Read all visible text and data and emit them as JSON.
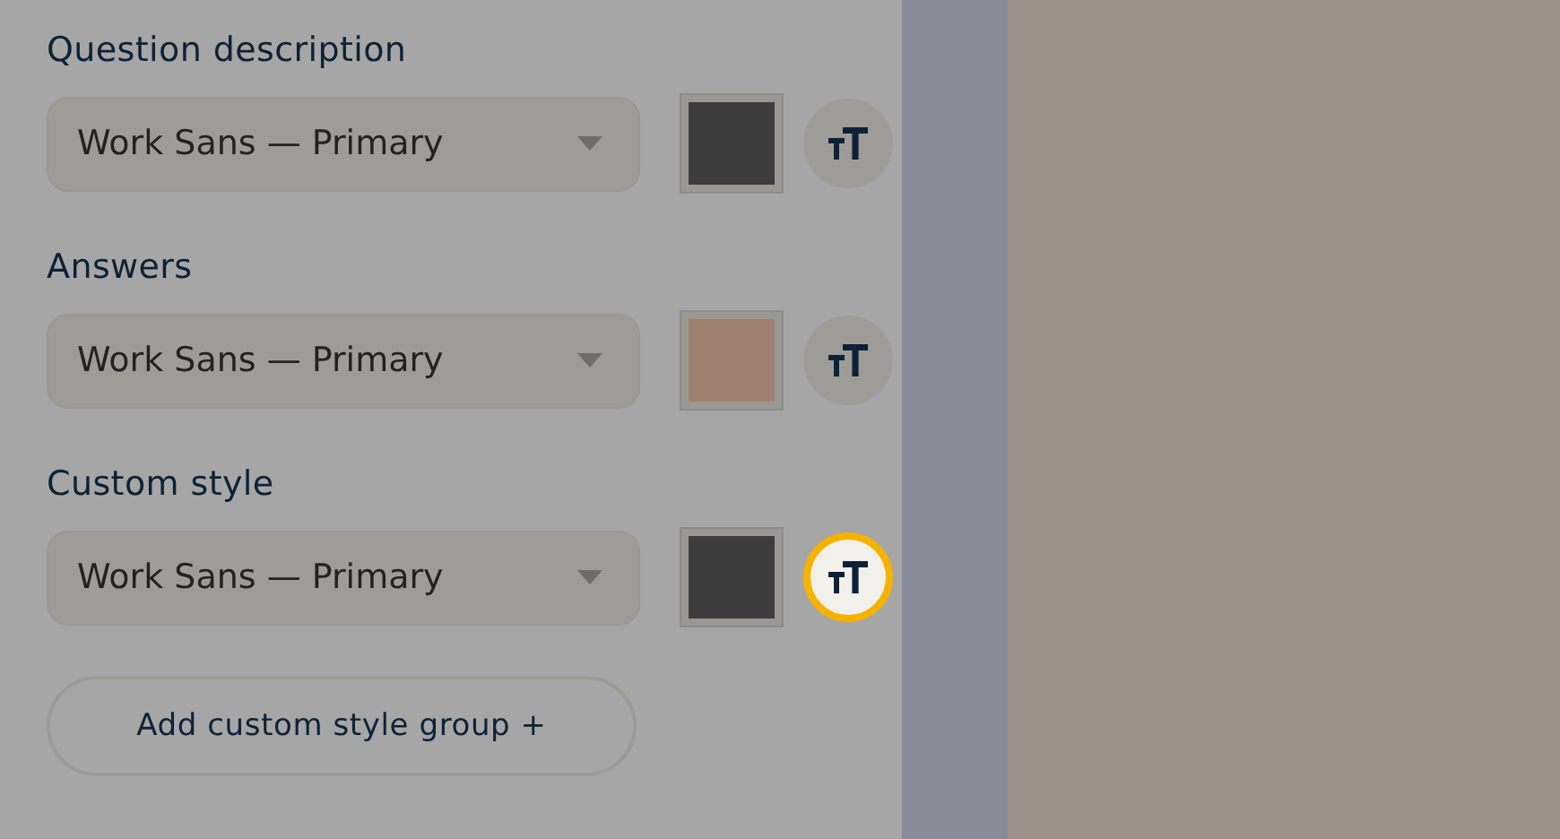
{
  "style_groups": [
    {
      "label": "Question description",
      "font": "Work Sans — Primary",
      "color": "#3d3d3d",
      "text_size_button": {
        "highlighted": false
      }
    },
    {
      "label": "Answers",
      "font": "Work Sans — Primary",
      "color": "#9d8070",
      "text_size_button": {
        "highlighted": false
      }
    },
    {
      "label": "Custom style",
      "font": "Work Sans — Primary",
      "color": "#3d3d3d",
      "text_size_button": {
        "highlighted": true
      }
    }
  ],
  "add_button": "Add custom style group +"
}
